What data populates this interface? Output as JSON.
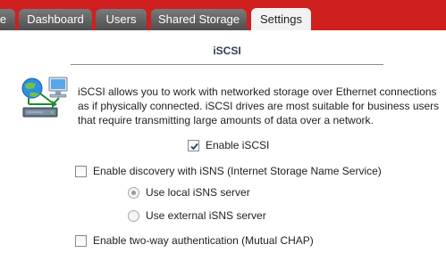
{
  "colors": {
    "topbar": "#cf1f1f",
    "tab_inactive": "#5f5f5f",
    "tab_active": "#f2f2f2",
    "section_title": "#2d3f57"
  },
  "tabs": [
    {
      "label": "e",
      "active": false
    },
    {
      "label": "Dashboard",
      "active": false
    },
    {
      "label": "Users",
      "active": false
    },
    {
      "label": "Shared Storage",
      "active": false
    },
    {
      "label": "Settings",
      "active": true
    }
  ],
  "section": {
    "title": "iSCSI",
    "icon": "network-storage-icon",
    "description": "iSCSI allows you to work with networked storage over Ethernet connections as if physically connected. iSCSI drives are most suitable for business users that require transmitting large amounts of data over a network."
  },
  "options": {
    "enable_iscsi": {
      "label": "Enable iSCSI",
      "checked": true
    },
    "enable_isns": {
      "label": "Enable discovery with iSNS (Internet Storage Name Service)",
      "checked": false
    },
    "isns_local": {
      "label": "Use local iSNS server",
      "selected": true,
      "enabled": false
    },
    "isns_external": {
      "label": "Use external iSNS server",
      "selected": false,
      "enabled": false
    },
    "enable_chap": {
      "label": "Enable two-way authentication (Mutual CHAP)",
      "checked": false
    }
  }
}
